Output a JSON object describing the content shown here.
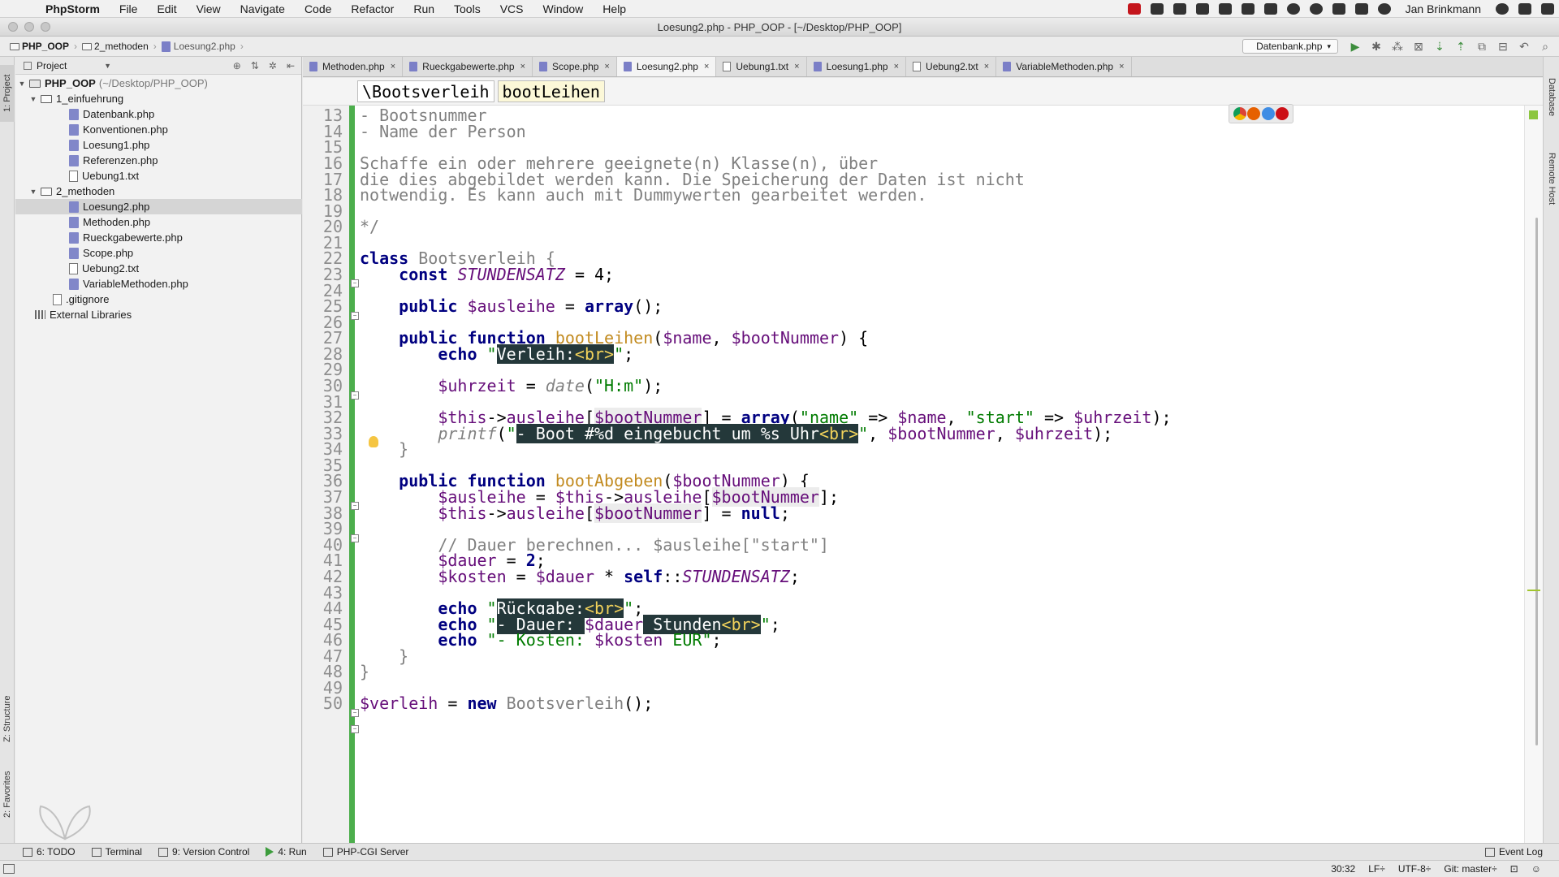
{
  "menubar": {
    "app": "PhpStorm",
    "items": [
      "File",
      "Edit",
      "View",
      "Navigate",
      "Code",
      "Refactor",
      "Run",
      "Tools",
      "VCS",
      "Window",
      "Help"
    ],
    "user": "Jan Brinkmann"
  },
  "window": {
    "title": "Loesung2.php - PHP_OOP - [~/Desktop/PHP_OOP]"
  },
  "navbar": {
    "crumbs": [
      "PHP_OOP",
      "2_methoden",
      "Loesung2.php"
    ],
    "run_config": "Datenbank.php"
  },
  "left_strip": {
    "project": "1: Project",
    "structure": "Z: Structure",
    "favorites": "2: Favorites"
  },
  "right_strip": {
    "database": "Database",
    "remote": "Remote Host"
  },
  "project_panel": {
    "selector": "Project",
    "root_name": "PHP_OOP",
    "root_path": "(~/Desktop/PHP_OOP)",
    "folder1": "1_einfuehrung",
    "folder1_files": [
      "Datenbank.php",
      "Konventionen.php",
      "Loesung1.php",
      "Referenzen.php",
      "Uebung1.txt"
    ],
    "folder2": "2_methoden",
    "folder2_files": [
      "Loesung2.php",
      "Methoden.php",
      "Rueckgabewerte.php",
      "Scope.php",
      "Uebung2.txt",
      "VariableMethoden.php"
    ],
    "gitignore": ".gitignore",
    "external": "External Libraries"
  },
  "tabs": [
    {
      "label": "Methoden.php",
      "type": "php"
    },
    {
      "label": "Rueckgabewerte.php",
      "type": "php"
    },
    {
      "label": "Scope.php",
      "type": "php"
    },
    {
      "label": "Loesung2.php",
      "type": "php",
      "active": true
    },
    {
      "label": "Uebung1.txt",
      "type": "txt"
    },
    {
      "label": "Loesung1.php",
      "type": "php"
    },
    {
      "label": "Uebung2.txt",
      "type": "txt"
    },
    {
      "label": "VariableMethoden.php",
      "type": "php"
    }
  ],
  "editor": {
    "breadcrumb_class": "\\Bootsverleih",
    "breadcrumb_method": "bootLeihen",
    "line_numbers": [
      "13",
      "14",
      "15",
      "16",
      "17",
      "18",
      "19",
      "20",
      "21",
      "22",
      "23",
      "24",
      "25",
      "26",
      "27",
      "28",
      "29",
      "30",
      "31",
      "32",
      "33",
      "34",
      "35",
      "36",
      "37",
      "38",
      "39",
      "40",
      "41",
      "42",
      "43",
      "44",
      "45",
      "46",
      "47",
      "48",
      "49",
      "50"
    ],
    "code": {
      "l13": "- Bootsnummer",
      "l14": "- Name der Person",
      "l16": "Schaffe ein oder mehrere geeignete(n) Klasse(n), über",
      "l17": "die dies abgebildet werden kann. Die Speicherung der Daten ist nicht",
      "l18": "notwendig. Es kann auch mit Dummywerten gearbeitet werden.",
      "l20": "*/",
      "kw_class": "class",
      "cls_name": "Bootsverleih",
      "brace_open": "{",
      "brace_close": "}",
      "kw_const": "const",
      "const_name": "STUNDENSATZ",
      "const_val": "= 4;",
      "kw_public": "public",
      "var_ausleihe": "$ausleihe",
      "eq": " = ",
      "kw_array": "array",
      "paren_semi": "();",
      "kw_function": "function",
      "fn_bootLeihen": "bootLeihen",
      "params1_a": "$name",
      "comma": ", ",
      "params1_b": "$bootNummer",
      "paren_brace": ") {",
      "kw_echo": "echo",
      "str_verleih": "Verleih:",
      "tag_br": "<br>",
      "var_uhrzeit": "$uhrzeit",
      "fn_date": "date",
      "str_hm": "\"H:m\"",
      "var_this": "$this",
      "arrow": "->",
      "prop_ausleihe": "ausleihe",
      "str_name_key": "\"name\"",
      "fat_arrow": " => ",
      "str_start_key": "\"start\"",
      "fn_printf": "printf",
      "str_printf": "- Boot #%d eingebucht um %s Uhr",
      "fn_bootAbgeben": "bootAbgeben",
      "kw_null": "null",
      "comment_dauer": "// Dauer berechnen... $ausleihe[\"start\"]",
      "var_dauer": "$dauer",
      "val_2": "2",
      "var_kosten": "$kosten",
      "mult": " * ",
      "kw_self": "self",
      "dcolon": "::",
      "str_rueckgabe": "Rückgabe:",
      "str_dauer_label": "- Dauer: ",
      "str_stunden": " Stunden",
      "str_kosten_label": "- Kosten: ",
      "str_eur": " EUR",
      "var_verleih": "$verleih",
      "kw_new": "new",
      "l50_tail": "();"
    }
  },
  "toolwindows": [
    {
      "label": "6: TODO",
      "key": "6"
    },
    {
      "label": "Terminal"
    },
    {
      "label": "9: Version Control",
      "key": "9"
    },
    {
      "label": "4: Run",
      "key": "4"
    },
    {
      "label": "PHP-CGI Server"
    }
  ],
  "event_log": "Event Log",
  "status": {
    "position": "30:32",
    "line_sep": "LF÷",
    "encoding": "UTF-8÷",
    "vcs": "Git: master÷"
  },
  "colors": {
    "vcs_changed": "#4cae4c",
    "keyword": "#000080",
    "variable": "#660e7a",
    "string": "#007b00",
    "function_unused": "#c28b20",
    "injected_bg": "#24383a"
  }
}
